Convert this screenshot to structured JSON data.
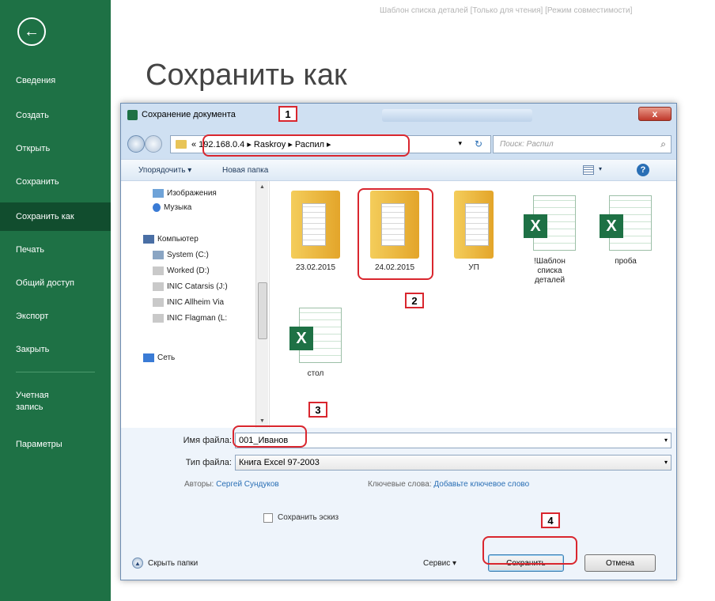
{
  "header": {
    "doc_title": "Шаблон списка деталей  [Только для чтения]  [Режим совместимости]",
    "page_heading": "Сохранить как"
  },
  "backstage": {
    "items": [
      {
        "label": "Сведения"
      },
      {
        "label": "Создать"
      },
      {
        "label": "Открыть"
      },
      {
        "label": "Сохранить"
      },
      {
        "label": "Сохранить как",
        "active": true
      },
      {
        "label": "Печать"
      },
      {
        "label": "Общий доступ"
      },
      {
        "label": "Экспорт"
      },
      {
        "label": "Закрыть"
      },
      {
        "label_line1": "Учетная",
        "label_line2": "запись"
      },
      {
        "label": "Параметры"
      }
    ]
  },
  "dialog": {
    "title": "Сохранение документа",
    "close_label": "x",
    "address": "« 192.168.0.4  ▸  Raskroy  ▸  Распил  ▸",
    "search_placeholder": "Поиск: Распил",
    "toolbar": {
      "organize": "Упорядочить ▾",
      "new_folder": "Новая папка"
    },
    "tree": [
      {
        "label": "Изображения",
        "icon": "pictures-icon"
      },
      {
        "label": "Музыка",
        "icon": "music-icon"
      },
      {
        "label": "Компьютер",
        "icon": "computer-icon"
      },
      {
        "label": "System (C:)",
        "icon": "drive-icon"
      },
      {
        "label": "Worked (D:)",
        "icon": "drive-icon"
      },
      {
        "label": "INIC Catarsis (J:)",
        "icon": "drive-icon"
      },
      {
        "label": "INIC Allheim Via",
        "icon": "drive-icon"
      },
      {
        "label": "INIC Flagman (L:",
        "icon": "drive-icon"
      },
      {
        "label": "Сеть",
        "icon": "network-icon"
      }
    ],
    "files": [
      {
        "label": "23.02.2015",
        "type": "folder"
      },
      {
        "label": "24.02.2015",
        "type": "folder"
      },
      {
        "label": "УП",
        "type": "folder"
      },
      {
        "label": "!Шаблон списка деталей",
        "type": "excel"
      },
      {
        "label": "проба",
        "type": "excel"
      },
      {
        "label": "стол",
        "type": "excel"
      }
    ],
    "form": {
      "filename_label": "Имя файла:",
      "filename_value": "001_Иванов",
      "filetype_label": "Тип файла:",
      "filetype_value": "Книга Excel 97-2003",
      "authors_label": "Авторы:",
      "authors_value": "Сергей Сундуков",
      "keywords_label": "Ключевые слова:",
      "keywords_value": "Добавьте ключевое слово",
      "thumbnail_label": "Сохранить эскиз",
      "hide_folders": "Скрыть папки",
      "service": "Сервис  ▾",
      "save": "Сохранить",
      "cancel": "Отмена"
    }
  },
  "callouts": [
    "1",
    "2",
    "3",
    "4"
  ],
  "colors": {
    "backstage_bg": "#1e7145",
    "callout": "#d9262e"
  }
}
